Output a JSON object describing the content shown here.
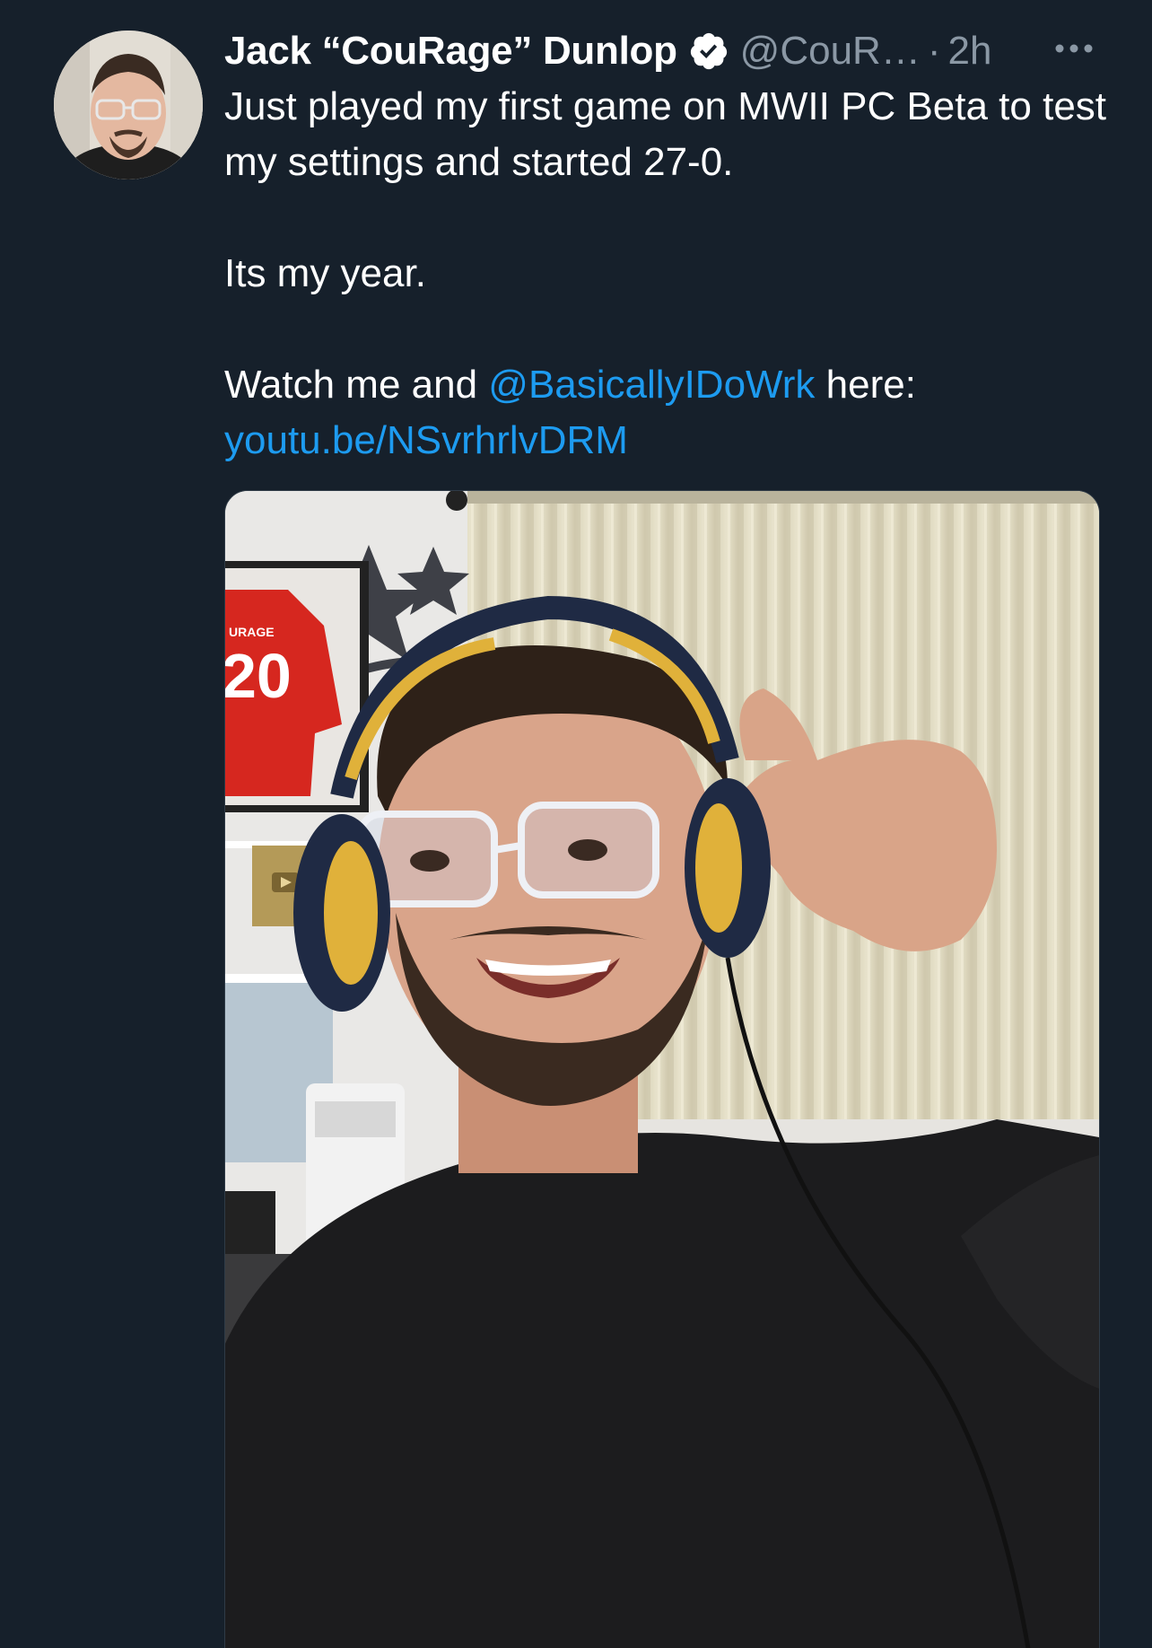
{
  "tweet": {
    "author": {
      "display_name": "Jack “CouRage” Dunlop",
      "handle": "@CouR…",
      "verified": true
    },
    "separator": "·",
    "timestamp": "2h",
    "text": {
      "line1": "Just played my first game on MWII PC Beta to test my settings and started 27-0.",
      "line2": "Its my year.",
      "line3_prefix": "Watch me and ",
      "mention": "@BasicallyIDoWrk",
      "line3_suffix": " here:",
      "url": "youtu.be/NSvrhrlvDRM"
    },
    "photo": {
      "jersey_name": "URAGE",
      "jersey_number": "20"
    }
  },
  "colors": {
    "background": "#16202b",
    "link": "#1d9bf0",
    "muted": "#8b98a5",
    "text": "#ffffff"
  },
  "icons": {
    "verified": "verified-badge-icon",
    "more": "more-horizontal-icon"
  }
}
